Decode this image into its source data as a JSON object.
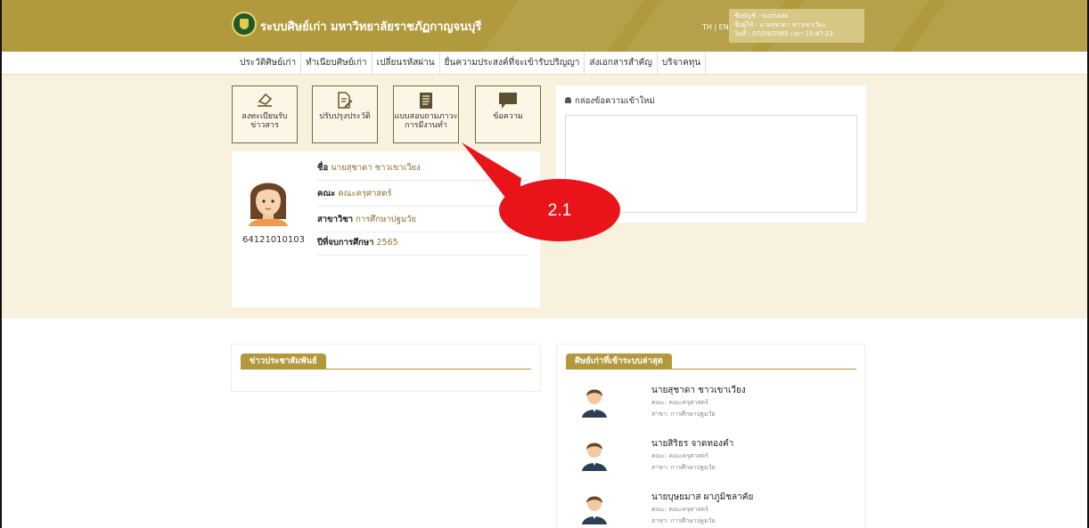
{
  "header": {
    "site_title": "ระบบศิษย์เก่า มหาวิทยาลัยราชภัฏกาญจนบุรี",
    "lang_switch": "TH | EN",
    "user_box": {
      "account": "ชื่อบัญชี : suchada",
      "user": "ชื่อผู้ใช้ : นายสุชาดา ชาวเขาเวียง",
      "date": "วันที่ : 07/09/2565 เวลา 15:47:23"
    }
  },
  "menu": [
    "ประวัติศิษย์เก่า",
    "ทำเนียบศิษย์เก่า",
    "เปลี่ยนรหัสผ่าน",
    "ยื่นความประสงค์ที่จะเข้ารับปริญญา",
    "ส่งเอกสารสำคัญ",
    "บริจาคทุน"
  ],
  "tiles": [
    {
      "label": "ลงทะเบียนรับข่าวสาร",
      "icon": "eraser-icon"
    },
    {
      "label": "ปรับปรุงประวัติ",
      "icon": "edit-document-icon"
    },
    {
      "label": "แบบสอบถามภาวะการมีงานทำ",
      "icon": "form-document-icon"
    },
    {
      "label": "ข้อความ",
      "icon": "message-icon"
    }
  ],
  "profile": {
    "student_id": "64121010103",
    "name_label": "ชื่อ",
    "name": "นายสุชาดา ชาวเขาเวียง",
    "faculty_label": "คณะ",
    "faculty": "คณะครุศาสตร์",
    "major_label": "สาขาวิชา",
    "major": "การศึกษาปฐมวัย",
    "year_label": "ปีที่จบการศึกษา",
    "year": "2565"
  },
  "message_box": {
    "title": "กล่องข้อความเข้าใหม่"
  },
  "callout": {
    "label": "2.1",
    "color": "#e8141a"
  },
  "news_panel": {
    "title": "ข่าวประชาสัมพันธ์"
  },
  "recent_panel": {
    "title": "ศิษย์เก่าที่เข้าระบบล่าสุด",
    "items": [
      {
        "name": "นายสุชาดา ชาวเขาเวียง",
        "faculty": "คณะ: คณะครุศาสตร์",
        "major": "สาขา: การศึกษาปฐมวัย"
      },
      {
        "name": "นายสิริธร จาดทองคำ",
        "faculty": "คณะ: คณะครุศาสตร์",
        "major": "สาขา: การศึกษาปฐมวัย"
      },
      {
        "name": "นายบุษยมาส ผาภูมิชลาคัย",
        "faculty": "คณะ: คณะครุศาสตร์",
        "major": "สาขา: การศึกษาปฐมวัย"
      }
    ]
  },
  "colors": {
    "brand": "#b19a3d",
    "cream": "#f7f1de",
    "accent_text": "#8a7430"
  }
}
